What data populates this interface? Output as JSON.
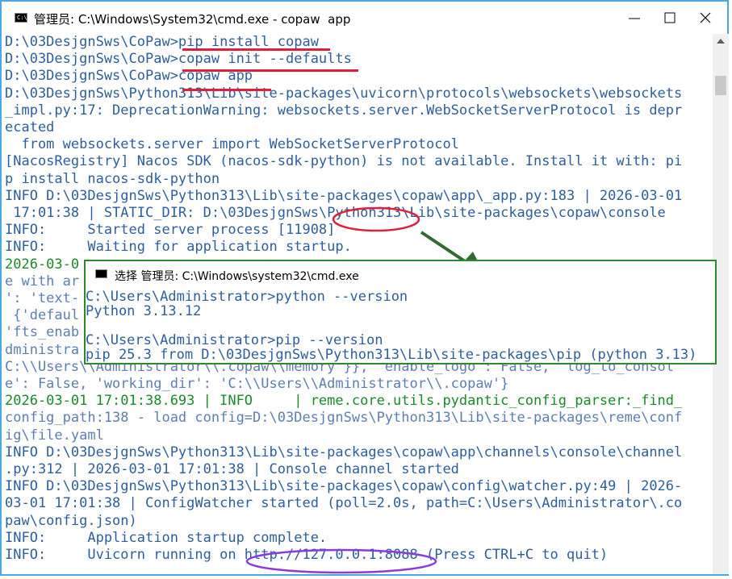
{
  "window": {
    "title": "管理员: C:\\Windows\\System32\\cmd.exe - copaw  app",
    "icon": "cmd-icon",
    "buttons": [
      "minimize",
      "maximize",
      "close"
    ]
  },
  "terminal": {
    "lines": [
      {
        "text": "D:\\03DesjgnSws\\CoPaw>pip install copaw",
        "cls": "b"
      },
      {
        "text": "D:\\03DesjgnSws\\CoPaw>copaw init --defaults",
        "cls": "b"
      },
      {
        "text": "D:\\03DesjgnSws\\CoPaw>copaw app",
        "cls": "b"
      },
      {
        "text": "D:\\03DesjgnSws\\Python313\\Lib\\site-packages\\uvicorn\\protocols\\websockets\\websockets",
        "cls": "b"
      },
      {
        "text": "_impl.py:17: DeprecationWarning: websockets.server.WebSocketServerProtocol is depr",
        "cls": "b"
      },
      {
        "text": "ecated",
        "cls": "b"
      },
      {
        "text": "  from websockets.server import WebSocketServerProtocol",
        "cls": "b"
      },
      {
        "text": "[NacosRegistry] Nacos SDK (nacos-sdk-python) is not available. Install it with: pi",
        "cls": "b"
      },
      {
        "text": "p install nacos-sdk-python",
        "cls": "b"
      },
      {
        "text": "INFO D:\\03DesjgnSws\\Python313\\Lib\\site-packages\\copaw\\app\\_app.py:183 | 2026-03-01",
        "cls": "b"
      },
      {
        "text": " 17:01:38 | STATIC_DIR: D:\\03DesjgnSws\\Python313\\Lib\\site-packages\\copaw\\console",
        "cls": "b"
      },
      {
        "text": "INFO:     Started server process [11908]",
        "cls": "b"
      },
      {
        "text": "INFO:     Waiting for application startup.",
        "cls": "b"
      },
      {
        "text": "2026-03-0",
        "cls": "g"
      },
      {
        "text": "e with ar",
        "cls": "m"
      },
      {
        "text": "': 'text-",
        "cls": "m"
      },
      {
        "text": " {'defaul",
        "cls": "m"
      },
      {
        "text": "'fts_enab",
        "cls": "m"
      },
      {
        "text": "dministra",
        "cls": "m"
      },
      {
        "text": "C:\\\\Users\\\\Administrator\\\\.copaw\\\\memory'}}, 'enable_logo': False, 'log_to_consol",
        "cls": "m"
      },
      {
        "text": "e': False, 'working_dir': 'C:\\\\Users\\\\Administrator\\\\.copaw'}",
        "cls": "m"
      },
      {
        "text": "2026-03-01 17:01:38.693 | INFO     | reme.core.utils.pydantic_config_parser:_find_",
        "cls": "g"
      },
      {
        "text": "config_path:138 - load config=D:\\03DesjgnSws\\Python313\\Lib\\site-packages\\reme\\conf",
        "cls": "m"
      },
      {
        "text": "ig\\file.yaml",
        "cls": "m"
      },
      {
        "text": "INFO D:\\03DesjgnSws\\Python313\\Lib\\site-packages\\copaw\\app\\channels\\console\\channel",
        "cls": "b"
      },
      {
        "text": ".py:312 | 2026-03-01 17:01:38 | Console channel started",
        "cls": "b"
      },
      {
        "text": "INFO D:\\03DesjgnSws\\Python313\\Lib\\site-packages\\copaw\\config\\watcher.py:49 | 2026-",
        "cls": "b"
      },
      {
        "text": "03-01 17:01:38 | ConfigWatcher started (poll=2.0s, path=C:\\Users\\Administrator\\.co",
        "cls": "b"
      },
      {
        "text": "paw\\config.json)",
        "cls": "b"
      },
      {
        "text": "INFO:     Application startup complete.",
        "cls": "b"
      },
      {
        "text": "INFO:     Uvicorn running on http://127.0.0.1:8088 (Press CTRL+C to quit)",
        "cls": "b"
      }
    ]
  },
  "popup": {
    "title": "选择 管理员: C:\\Windows\\system32\\cmd.exe",
    "lines": [
      "C:\\Users\\Administrator>python --version",
      "Python 3.13.12",
      "",
      "C:\\Users\\Administrator>pip --version",
      "pip 25.3 from D:\\03DesjgnSws\\Python313\\Lib\\site-packages\\pip (python 3.13)"
    ]
  },
  "annotations": {
    "underline_color": "#e0203a",
    "circle_red_color": "#e0203a",
    "circle_purple_color": "#8a3be0",
    "arrow_color": "#2f6a2f",
    "popup_border_color": "#2c8a2c"
  }
}
